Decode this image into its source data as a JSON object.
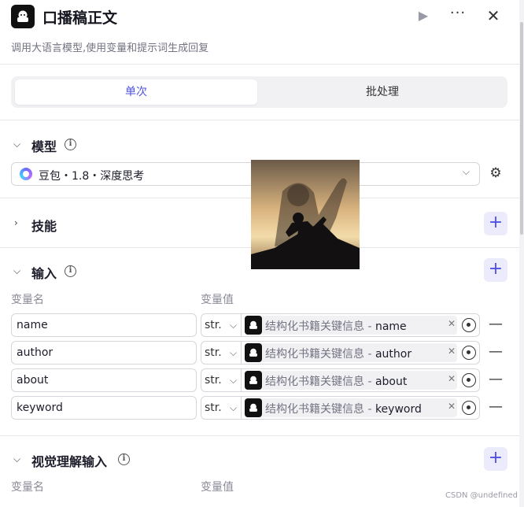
{
  "header": {
    "title": "口播稿正文",
    "description": "调用大语言模型,使用变量和提示词生成回复",
    "run_icon": "play-icon",
    "more_icon": "more-icon",
    "close_icon": "close-icon"
  },
  "tabs": [
    {
      "label": "单次",
      "active": true
    },
    {
      "label": "批处理",
      "active": false
    }
  ],
  "model": {
    "section_title": "模型",
    "selected": "豆包・1.8・深度思考"
  },
  "skills": {
    "section_title": "技能"
  },
  "inputs": {
    "section_title": "输入",
    "col_name": "变量名",
    "col_value": "变量值",
    "rows": [
      {
        "name": "name",
        "type": "str.",
        "source": "结构化书籍关键信息",
        "separator": " - ",
        "field": "name"
      },
      {
        "name": "author",
        "type": "str.",
        "source": "结构化书籍关键信息",
        "separator": " - ",
        "field": "author"
      },
      {
        "name": "about",
        "type": "str.",
        "source": "结构化书籍关键信息",
        "separator": " - ",
        "field": "about"
      },
      {
        "name": "keyword",
        "type": "str.",
        "source": "结构化书籍关键信息",
        "separator": " - ",
        "field": "keyword"
      }
    ]
  },
  "visual_inputs": {
    "section_title": "视觉理解输入",
    "col_name": "变量名",
    "col_value": "变量值"
  },
  "watermark": "CSDN @undefined",
  "colors": {
    "accent": "#4f51e6",
    "accent_bg": "#ebebfc"
  }
}
